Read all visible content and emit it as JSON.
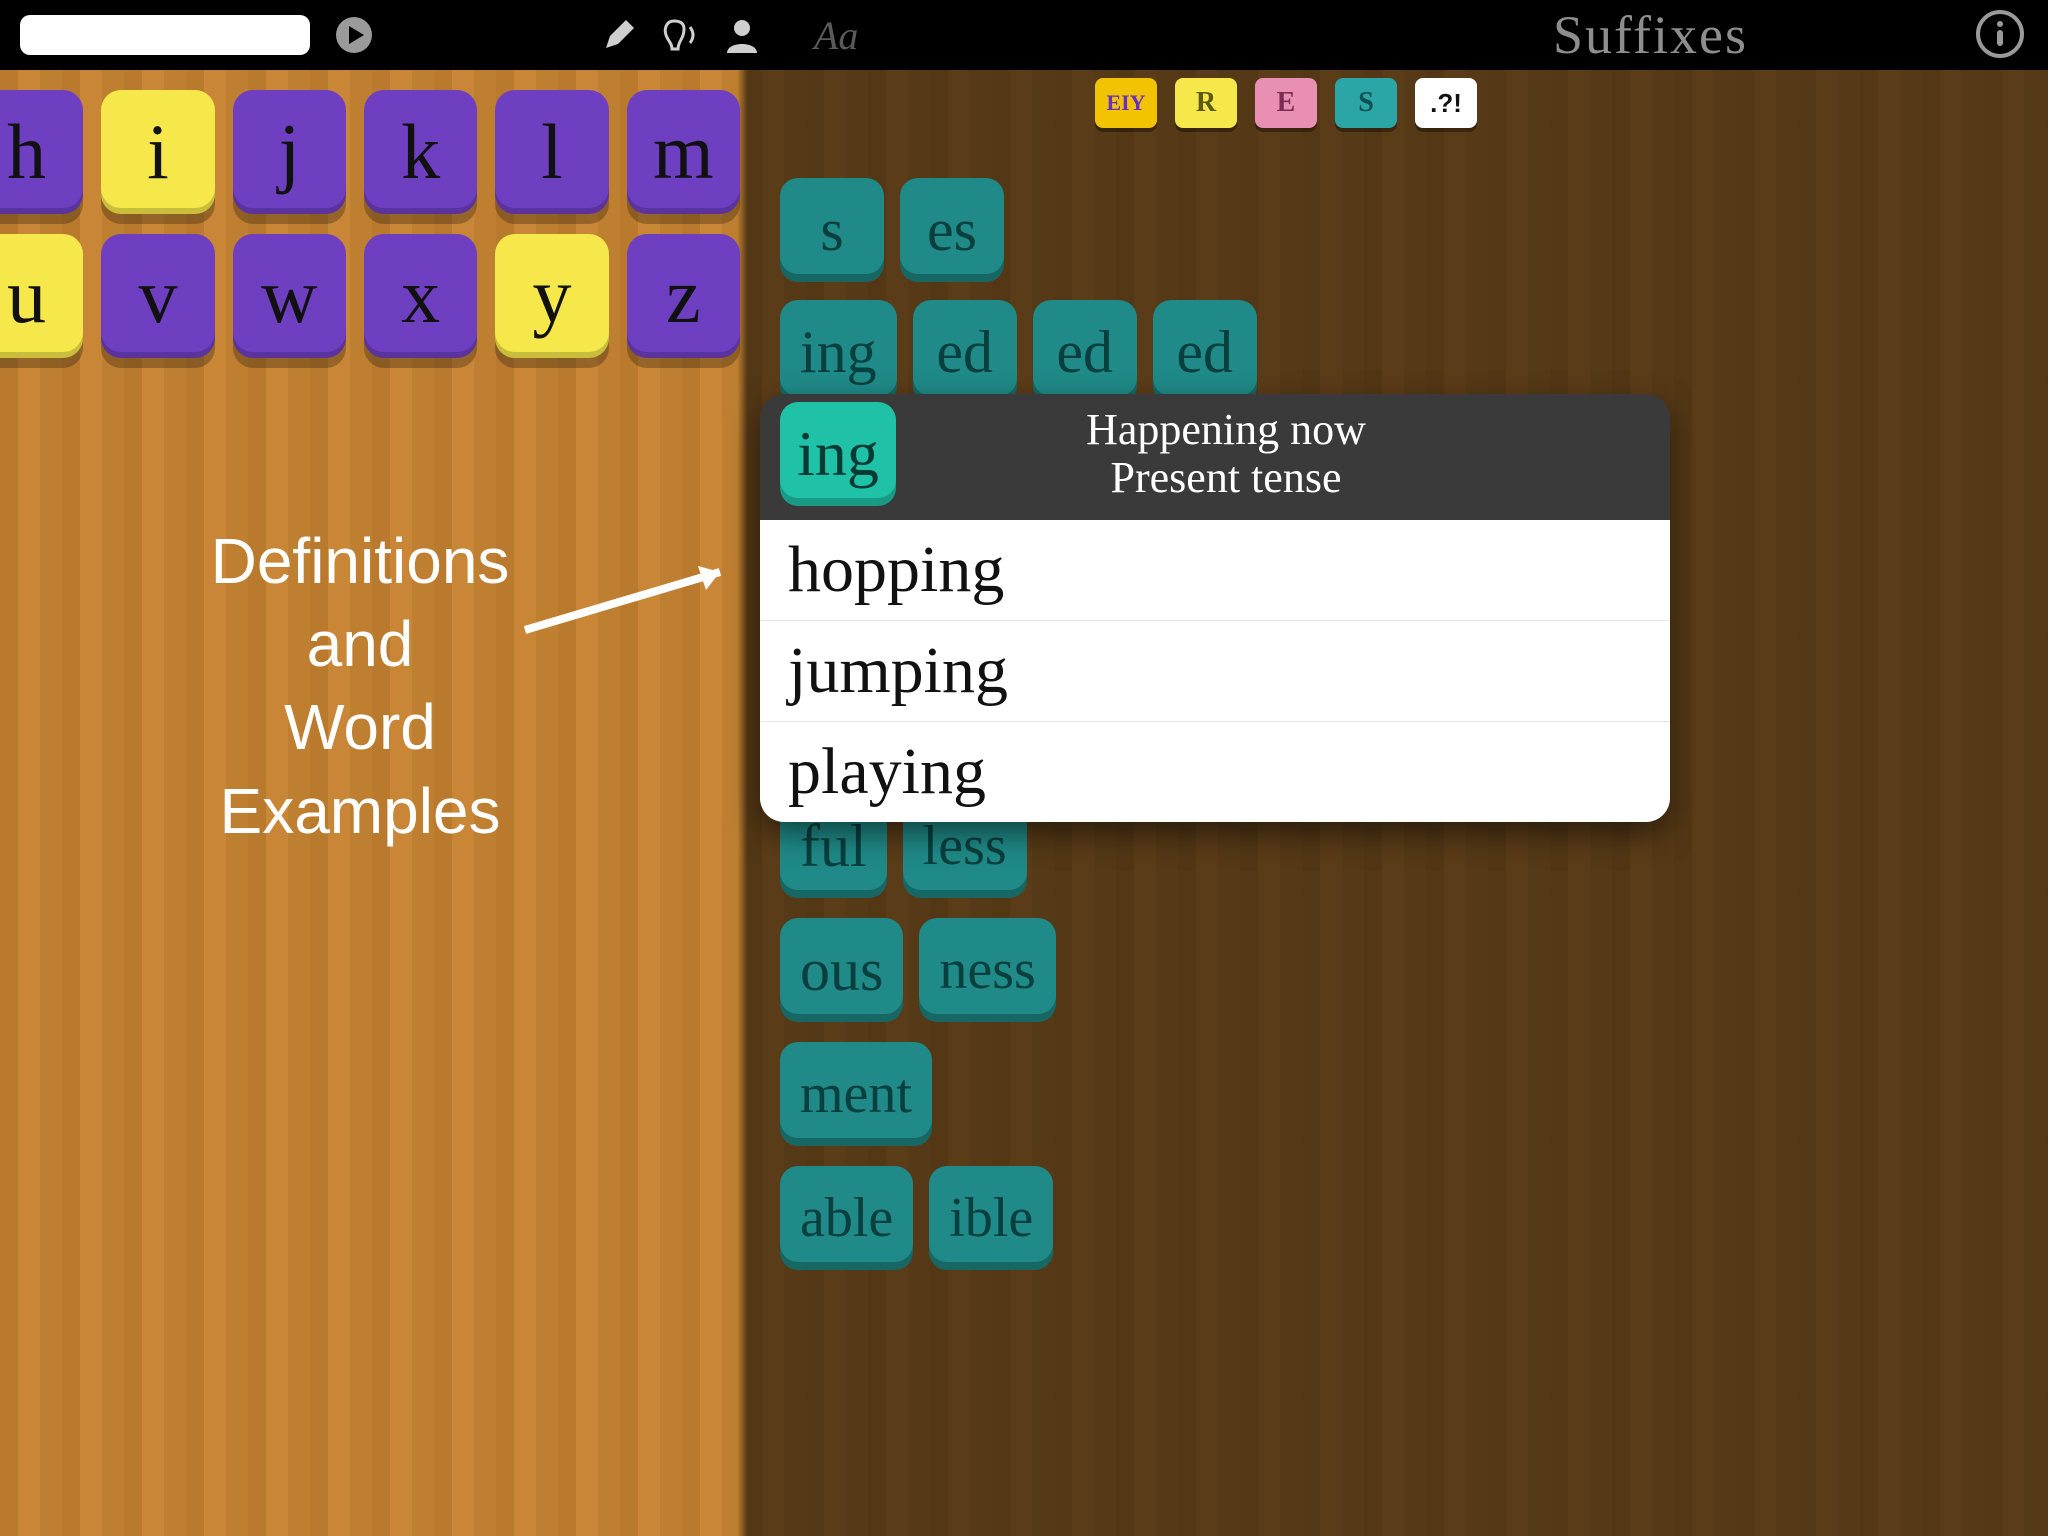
{
  "header": {
    "search_value": "",
    "search_placeholder": "",
    "title": "Suffixes",
    "aa": "Aa"
  },
  "filters": {
    "eiy": "EIY",
    "r": "R",
    "e": "E",
    "s": "S",
    "punc": ".?!"
  },
  "letters_row1": [
    "h",
    "i",
    "j",
    "k",
    "l",
    "m"
  ],
  "letters_row1_highlight": [
    false,
    true,
    false,
    false,
    false,
    false
  ],
  "letters_row2": [
    "u",
    "v",
    "w",
    "x",
    "y",
    "z"
  ],
  "letters_row2_highlight": [
    true,
    false,
    false,
    false,
    true,
    false
  ],
  "suffix_rows": [
    [
      "s",
      "es"
    ],
    [
      "ing",
      "ed",
      "ed",
      "ed"
    ],
    [
      "ful",
      "less"
    ],
    [
      "ous",
      "ness"
    ],
    [
      "ment"
    ],
    [
      "able",
      "ible"
    ]
  ],
  "popover": {
    "tile": "ing",
    "line1": "Happening now",
    "line2": "Present tense",
    "examples": [
      "hopping",
      "jumping",
      "playing"
    ]
  },
  "annotation": {
    "l1": "Definitions",
    "l2": "and",
    "l3": "Word",
    "l4": "Examples"
  }
}
